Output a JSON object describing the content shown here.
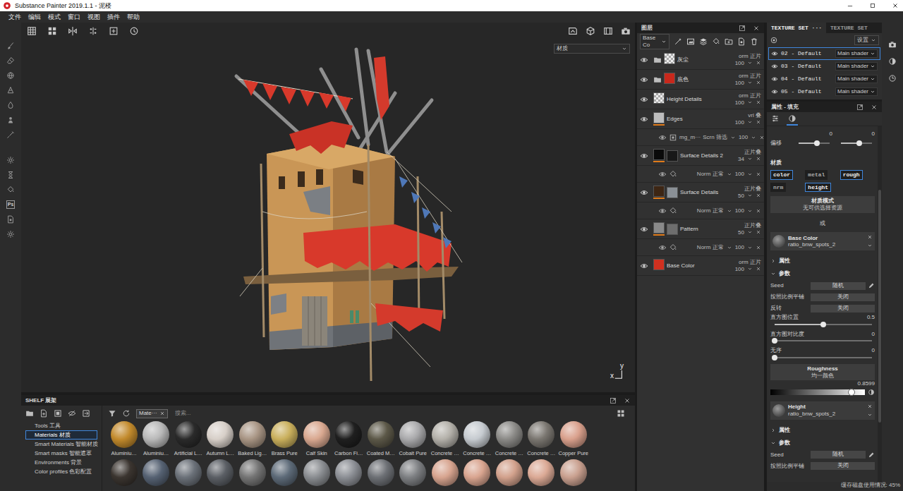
{
  "window": {
    "title": "Substance Painter 2019.1.1 - 泥楼"
  },
  "menu": [
    "文件",
    "编辑",
    "模式",
    "窗口",
    "视图",
    "插件",
    "帮助"
  ],
  "left_tools": {
    "ps_label": "Ps"
  },
  "viewport": {
    "channel": "材质",
    "axis": {
      "x": "x",
      "y": "y"
    }
  },
  "shelf": {
    "title": "SHELF 展架",
    "categories": [
      {
        "label": "Tools 工具",
        "selected": false
      },
      {
        "label": "Materials 材质",
        "selected": true
      },
      {
        "label": "Smart Materials 智能材质",
        "selected": false
      },
      {
        "label": "Smart masks 智能遮罩",
        "selected": false
      },
      {
        "label": "Environments 背景",
        "selected": false
      },
      {
        "label": "Color profiles 色彩配置",
        "selected": false
      }
    ],
    "filter_tag": "Mate···",
    "search": {
      "placeholder": "搜索..."
    },
    "materials": [
      {
        "name": "Aluminiu…",
        "color": "#c28a2c"
      },
      {
        "name": "Aluminiu…",
        "color": "#b9b9b9"
      },
      {
        "name": "Artificial L…",
        "color": "#2a2a2a"
      },
      {
        "name": "Autumn L…",
        "color": "#d7cfc8"
      },
      {
        "name": "Baked Lig…",
        "color": "#a89584"
      },
      {
        "name": "Brass Pure",
        "color": "#c9af5c"
      },
      {
        "name": "Calf Skin",
        "color": "#d9a890"
      },
      {
        "name": "Carbon Fi…",
        "color": "#1f1f1f"
      },
      {
        "name": "Coated M…",
        "color": "#5c5848"
      },
      {
        "name": "Cobalt Pure",
        "color": "#a9a9ab"
      },
      {
        "name": "Concrete …",
        "color": "#b3b0a9"
      },
      {
        "name": "Concrete …",
        "color": "#c6cbd0"
      },
      {
        "name": "Concrete …",
        "color": "#8b8a87"
      },
      {
        "name": "Concrete …",
        "color": "#7a7670"
      },
      {
        "name": "Copper Pure",
        "color": "#d9a08c"
      }
    ],
    "more_materials": [
      {
        "color": "#3b3530"
      },
      {
        "color": "#566273"
      },
      {
        "color": "#6b7179"
      },
      {
        "color": "#5b5f65"
      },
      {
        "color": "#747474"
      },
      {
        "color": "#5d6a78"
      },
      {
        "color": "#8a8d91"
      },
      {
        "color": "#8c8f95"
      },
      {
        "color": "#6d7075"
      },
      {
        "color": "#7d7f82"
      },
      {
        "color": "#d7a48f"
      },
      {
        "color": "#d9a590"
      },
      {
        "color": "#d2a18c"
      },
      {
        "color": "#dba995"
      },
      {
        "color": "#c9a08f"
      }
    ]
  },
  "layers": {
    "title": "图层",
    "channel": "Base Co",
    "items": [
      {
        "kind": "folder",
        "name": "灰尘",
        "blend": "orm 正片",
        "opacity": "100",
        "visible": true,
        "color": "#e6e6e6",
        "checkered": true,
        "masked": false
      },
      {
        "kind": "folder",
        "name": "底色",
        "blend": "orm 正片",
        "opacity": "100",
        "visible": true,
        "color": "#c8281c",
        "checkered": false,
        "masked": false
      },
      {
        "kind": "fill",
        "name": "Height Details",
        "blend": "orm 正片",
        "opacity": "100",
        "visible": true,
        "color": "#e6e6e6",
        "checkered": true,
        "masked": false
      },
      {
        "kind": "fill",
        "name": "Edges",
        "blend": "vrl 叠",
        "opacity": "100",
        "visible": true,
        "color": "#bdbdbd",
        "checkered": false,
        "masked": true,
        "effect": {
          "kind": "generator",
          "name": "mg_m···",
          "blend": "Scrn 筛选",
          "opacity": "100",
          "visible": true
        }
      },
      {
        "kind": "fill",
        "name": "Surface Details 2",
        "blend": "正片叠",
        "opacity": "34",
        "visible": true,
        "color": "#0a0a0a",
        "mask_color": "#181818",
        "checkered": false,
        "masked": true,
        "effect": {
          "kind": "fill",
          "blend": "Norm 正常",
          "opacity": "100",
          "visible": true
        }
      },
      {
        "kind": "fill",
        "name": "Surface Details",
        "blend": "正片叠",
        "opacity": "50",
        "visible": true,
        "color": "#3d2614",
        "mask_color": "#8a9096",
        "checkered": false,
        "masked": true,
        "effect": {
          "kind": "fill",
          "blend": "Norm 正常",
          "opacity": "100",
          "visible": true
        }
      },
      {
        "kind": "fill",
        "name": "Pattern",
        "blend": "正片叠",
        "opacity": "50",
        "visible": true,
        "color": "#8a8a8a",
        "mask_color": "#6e6e6e",
        "checkered": false,
        "masked": true,
        "effect": {
          "kind": "fill",
          "blend": "Norm 正常",
          "opacity": "100",
          "visible": true
        }
      },
      {
        "kind": "fill",
        "name": "Base Color",
        "blend": "orm 正片",
        "opacity": "100",
        "visible": true,
        "color": "#d0301f",
        "checkered": false,
        "masked": false
      }
    ]
  },
  "texture_sets": {
    "tabs": [
      {
        "label": "TEXTURE SET ···",
        "selected": true
      },
      {
        "label": "TEXTURE SET",
        "selected": false
      }
    ],
    "settings": "设置",
    "items": [
      {
        "name": "02 - Default",
        "shader": "Main shader",
        "visible": true,
        "selected": true
      },
      {
        "name": "03 - Default",
        "shader": "Main shader",
        "visible": true,
        "selected": false
      },
      {
        "name": "04 - Default",
        "shader": "Main shader",
        "visible": true,
        "selected": false
      },
      {
        "name": "05 - Default",
        "shader": "Main shader",
        "visible": true,
        "selected": false
      }
    ]
  },
  "properties": {
    "title": "属性 - 填充",
    "tabs": [
      {
        "selected": false
      },
      {
        "selected": true
      }
    ],
    "offset": {
      "label": "偏移",
      "sliders": [
        {
          "value": "0",
          "level": 0.6
        },
        {
          "value": "0",
          "level": 0.6
        }
      ]
    },
    "material": {
      "label": "材质",
      "channels": [
        {
          "label": "color",
          "selected": true
        },
        {
          "label": "metal",
          "selected": false
        },
        {
          "label": "rough",
          "selected": true
        },
        {
          "label": "nrm",
          "selected": false
        },
        {
          "label": "height",
          "selected": true
        }
      ]
    },
    "mode": {
      "title": "材质模式",
      "subtitle": "无可供选择资源"
    },
    "or_label": "或",
    "sources": [
      {
        "kind": "resource",
        "title": "Base Color",
        "file": "ratio_bnw_spots_2",
        "groups": [
          {
            "label": "属性",
            "expanded": false
          },
          {
            "label": "参数",
            "expanded": true
          }
        ],
        "params": [
          {
            "kind": "seed",
            "label": "Seed",
            "value": "随机"
          },
          {
            "kind": "button",
            "label": "按照比例平铺",
            "value": "关闭"
          },
          {
            "kind": "button",
            "label": "反转",
            "value": "关闭"
          },
          {
            "kind": "slider",
            "label": "直方图位置",
            "value": "0.5",
            "level": 0.5
          },
          {
            "kind": "slider",
            "label": "直方图对比度",
            "value": "0",
            "level": 0
          },
          {
            "kind": "slider",
            "label": "无序",
            "value": "0",
            "level": 0
          }
        ]
      },
      {
        "kind": "uniform",
        "title": "Roughness",
        "subtitle": "均一颜色",
        "value": "0.8599",
        "level": 0.86
      },
      {
        "kind": "resource",
        "title": "Height",
        "file": "ratio_bnw_spots_2",
        "groups": [
          {
            "label": "属性",
            "expanded": false
          },
          {
            "label": "参数",
            "expanded": true
          }
        ],
        "params": [
          {
            "kind": "seed",
            "label": "Seed",
            "value": "随机"
          },
          {
            "kind": "button",
            "label": "按照比例平铺",
            "value": "关闭"
          }
        ]
      }
    ]
  },
  "status_bar": {
    "disk": "缓存磁盘使用情况: 45%"
  }
}
